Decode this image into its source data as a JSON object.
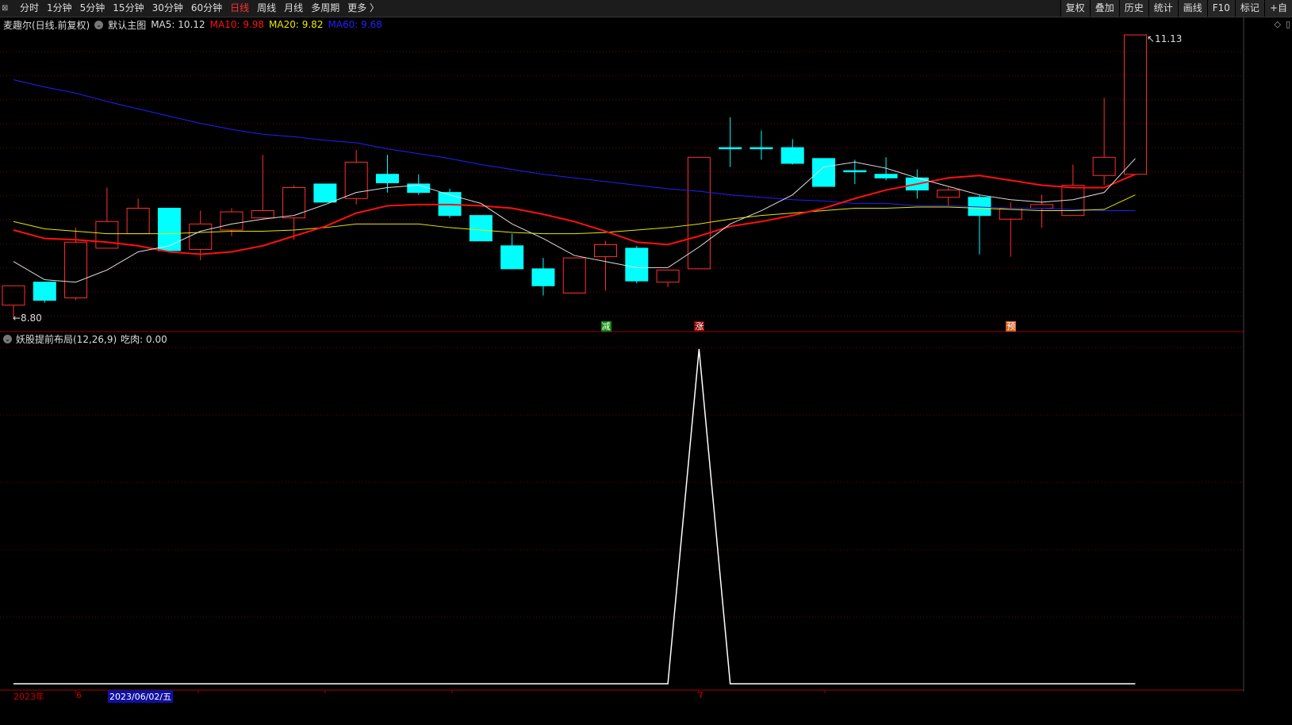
{
  "toolbar": {
    "tabs": [
      "分时",
      "1分钟",
      "5分钟",
      "15分钟",
      "30分钟",
      "60分钟",
      "日线",
      "周线",
      "月线",
      "多周期",
      "更多 〉"
    ],
    "active": "日线",
    "right": [
      "复权",
      "叠加",
      "历史",
      "统计",
      "画线",
      "F10",
      "标记",
      "+自"
    ]
  },
  "legend": {
    "title": "麦趣尔(日线.前复权)",
    "template": "默认主图",
    "ma5": "MA5: 10.12",
    "ma10": "MA10: 9.98",
    "ma20": "MA20: 9.82",
    "ma60": "MA60: 9.68"
  },
  "colors": {
    "up": "#ff3030",
    "down": "#00ffff",
    "ma5": "#dddddd",
    "ma10": "#ff1010",
    "ma20": "#e8e800",
    "ma60": "#2020ff",
    "grid": "#7a0000"
  },
  "price_labels": {
    "high": "11.13",
    "low": "8.80"
  },
  "signals": [
    {
      "index": 19,
      "text": "减",
      "color": "#0a8a0a"
    },
    {
      "index": 22,
      "text": "涨",
      "color": "#8b0000"
    },
    {
      "index": 32,
      "text": "预",
      "color": "#d2601a"
    }
  ],
  "sub": {
    "title": "妖股提前布局(12,26,9)",
    "value": "吃肉: 0.00"
  },
  "axis": {
    "year": "2023年",
    "m6": "6",
    "cursor": "2023/06/02/五",
    "m7": "7"
  },
  "chart_data": {
    "type": "candlestick",
    "ohlc": [
      [
        8.9,
        9.06,
        8.8,
        9.06
      ],
      [
        9.09,
        9.09,
        8.92,
        8.94
      ],
      [
        8.96,
        9.54,
        8.94,
        9.42
      ],
      [
        9.37,
        9.87,
        9.37,
        9.59
      ],
      [
        9.49,
        9.78,
        9.49,
        9.7
      ],
      [
        9.7,
        9.7,
        9.35,
        9.35
      ],
      [
        9.36,
        9.68,
        9.27,
        9.57
      ],
      [
        9.52,
        9.7,
        9.47,
        9.67
      ],
      [
        9.62,
        10.14,
        9.62,
        9.68
      ],
      [
        9.62,
        9.89,
        9.44,
        9.87
      ],
      [
        9.9,
        9.9,
        9.75,
        9.75
      ],
      [
        9.78,
        10.18,
        9.73,
        10.08
      ],
      [
        9.98,
        10.14,
        9.83,
        9.91
      ],
      [
        9.9,
        9.98,
        9.81,
        9.83
      ],
      [
        9.83,
        9.86,
        9.62,
        9.64
      ],
      [
        9.64,
        9.64,
        9.43,
        9.43
      ],
      [
        9.39,
        9.49,
        9.2,
        9.2
      ],
      [
        9.2,
        9.29,
        8.98,
        9.06
      ],
      [
        9.0,
        9.29,
        9.0,
        9.29
      ],
      [
        9.3,
        9.43,
        9.02,
        9.4
      ],
      [
        9.37,
        9.39,
        9.08,
        9.1
      ],
      [
        9.09,
        9.19,
        9.05,
        9.19
      ],
      [
        9.2,
        10.12,
        9.2,
        10.12
      ],
      [
        10.2,
        10.45,
        10.04,
        10.19
      ],
      [
        10.2,
        10.34,
        10.1,
        10.19
      ],
      [
        10.2,
        10.27,
        10.06,
        10.07
      ],
      [
        10.11,
        10.11,
        9.88,
        9.88
      ],
      [
        10.01,
        10.1,
        9.9,
        10.0
      ],
      [
        9.98,
        10.12,
        9.93,
        9.95
      ],
      [
        9.95,
        10.02,
        9.78,
        9.85
      ],
      [
        9.79,
        9.87,
        9.72,
        9.85
      ],
      [
        9.79,
        9.81,
        9.32,
        9.64
      ],
      [
        9.61,
        9.75,
        9.3,
        9.7
      ],
      [
        9.7,
        9.81,
        9.54,
        9.73
      ],
      [
        9.64,
        10.06,
        9.64,
        9.89
      ],
      [
        9.97,
        10.61,
        9.89,
        10.12
      ],
      [
        9.98,
        11.13,
        9.98,
        11.13
      ]
    ],
    "ma5": [
      9.26,
      9.11,
      9.09,
      9.19,
      9.34,
      9.39,
      9.51,
      9.57,
      9.61,
      9.64,
      9.73,
      9.83,
      9.87,
      9.89,
      9.81,
      9.74,
      9.57,
      9.45,
      9.31,
      9.26,
      9.21,
      9.21,
      9.38,
      9.57,
      9.68,
      9.81,
      10.04,
      10.08,
      10.03,
      9.95,
      9.88,
      9.81,
      9.77,
      9.75,
      9.77,
      9.83,
      10.11
    ],
    "ma10": [
      9.52,
      9.45,
      9.44,
      9.42,
      9.39,
      9.34,
      9.32,
      9.34,
      9.39,
      9.47,
      9.55,
      9.66,
      9.72,
      9.73,
      9.73,
      9.72,
      9.7,
      9.65,
      9.59,
      9.51,
      9.42,
      9.4,
      9.47,
      9.55,
      9.59,
      9.64,
      9.7,
      9.78,
      9.85,
      9.9,
      9.95,
      9.97,
      9.93,
      9.89,
      9.87,
      9.87,
      9.98
    ],
    "ma20": [
      9.59,
      9.53,
      9.51,
      9.49,
      9.49,
      9.49,
      9.5,
      9.51,
      9.51,
      9.52,
      9.54,
      9.57,
      9.57,
      9.57,
      9.54,
      9.52,
      9.5,
      9.49,
      9.49,
      9.5,
      9.52,
      9.54,
      9.57,
      9.61,
      9.64,
      9.66,
      9.68,
      9.7,
      9.7,
      9.71,
      9.71,
      9.7,
      9.69,
      9.68,
      9.68,
      9.69,
      9.81
    ],
    "ma60": [
      10.76,
      10.7,
      10.65,
      10.58,
      10.52,
      10.46,
      10.4,
      10.35,
      10.31,
      10.29,
      10.26,
      10.24,
      10.19,
      10.15,
      10.11,
      10.06,
      10.02,
      9.98,
      9.95,
      9.92,
      9.89,
      9.86,
      9.84,
      9.81,
      9.79,
      9.77,
      9.76,
      9.74,
      9.74,
      9.72,
      9.72,
      9.71,
      9.7,
      9.7,
      9.69,
      9.68,
      9.68
    ],
    "price_range": [
      8.8,
      11.13
    ],
    "indicator": [
      0,
      0,
      0,
      0,
      0,
      0,
      0,
      0,
      0,
      0,
      0,
      0,
      0,
      0,
      0,
      0,
      0,
      0,
      0,
      0,
      0,
      0,
      1,
      0,
      0,
      0,
      0,
      0,
      0,
      0,
      0,
      0,
      0,
      0,
      0,
      0,
      0
    ],
    "indicator_range": [
      0,
      1.05
    ]
  }
}
